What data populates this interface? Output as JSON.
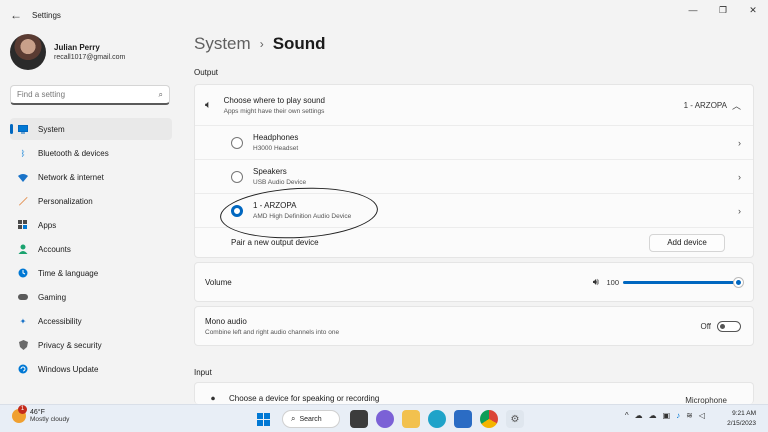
{
  "window": {
    "title": "Settings",
    "back_icon": "back-arrow-icon",
    "controls": [
      "minimize-icon",
      "maximize-icon",
      "close-icon"
    ]
  },
  "profile": {
    "name": "Julian Perry",
    "email": "recall1017@gmail.com"
  },
  "search": {
    "placeholder": "Find a setting",
    "value": ""
  },
  "nav": {
    "items": [
      {
        "label": "System",
        "icon": "monitor-icon",
        "color": "#0078d4",
        "active": true
      },
      {
        "label": "Bluetooth & devices",
        "icon": "bluetooth-icon",
        "color": "#0078d4"
      },
      {
        "label": "Network & internet",
        "icon": "wifi-icon",
        "color": "#1a73c8"
      },
      {
        "label": "Personalization",
        "icon": "brush-icon",
        "color": "#e07a2c"
      },
      {
        "label": "Apps",
        "icon": "apps-icon",
        "color": "#4a4a4a"
      },
      {
        "label": "Accounts",
        "icon": "person-icon",
        "color": "#1aa36f"
      },
      {
        "label": "Time & language",
        "icon": "globe-clock-icon",
        "color": "#0078d4"
      },
      {
        "label": "Gaming",
        "icon": "gamepad-icon",
        "color": "#5a5a5a"
      },
      {
        "label": "Accessibility",
        "icon": "accessibility-icon",
        "color": "#1a73c8"
      },
      {
        "label": "Privacy & security",
        "icon": "shield-icon",
        "color": "#6a6a6a"
      },
      {
        "label": "Windows Update",
        "icon": "update-icon",
        "color": "#0078d4"
      }
    ]
  },
  "breadcrumb": {
    "parent": "System",
    "separator": "›",
    "current": "Sound"
  },
  "output": {
    "heading": "Output",
    "choose": {
      "title": "Choose where to play sound",
      "subtitle": "Apps might have their own settings",
      "selected": "1 - ARZOPA",
      "icon": "speaker-icon"
    },
    "devices": [
      {
        "name": "Headphones",
        "detail": "H3000 Headset",
        "selected": false
      },
      {
        "name": "Speakers",
        "detail": "USB Audio Device",
        "selected": false
      },
      {
        "name": "1 - ARZOPA",
        "detail": "AMD High Definition Audio Device",
        "selected": true
      }
    ],
    "pair": {
      "label": "Pair a new output device",
      "button": "Add device"
    },
    "volume": {
      "label": "Volume",
      "value": "100",
      "level": 1.0
    },
    "mono": {
      "title": "Mono audio",
      "subtitle": "Combine left and right audio channels into one",
      "state_label": "Off",
      "on": false
    }
  },
  "input": {
    "heading": "Input",
    "choose": {
      "title": "Choose a device for speaking or recording",
      "selected": "Microphone",
      "icon": "microphone-icon"
    }
  },
  "taskbar": {
    "weather": {
      "badge": "1",
      "temp": "46°F",
      "condition": "Mostly cloudy"
    },
    "search_label": "Search",
    "pinned": [
      "start-icon",
      "file-manager-icon",
      "chat-icon",
      "folder-icon",
      "edge-icon",
      "store-icon",
      "chrome-icon",
      "settings-icon"
    ],
    "tray": [
      "chevron-up-icon",
      "cloud-icon",
      "onedrive-icon",
      "camera-icon",
      "microphone-icon",
      "wifi-icon",
      "volume-icon"
    ],
    "time": "9:21 AM",
    "date": "2/15/2023"
  },
  "colors": {
    "accent": "#0067c0"
  }
}
